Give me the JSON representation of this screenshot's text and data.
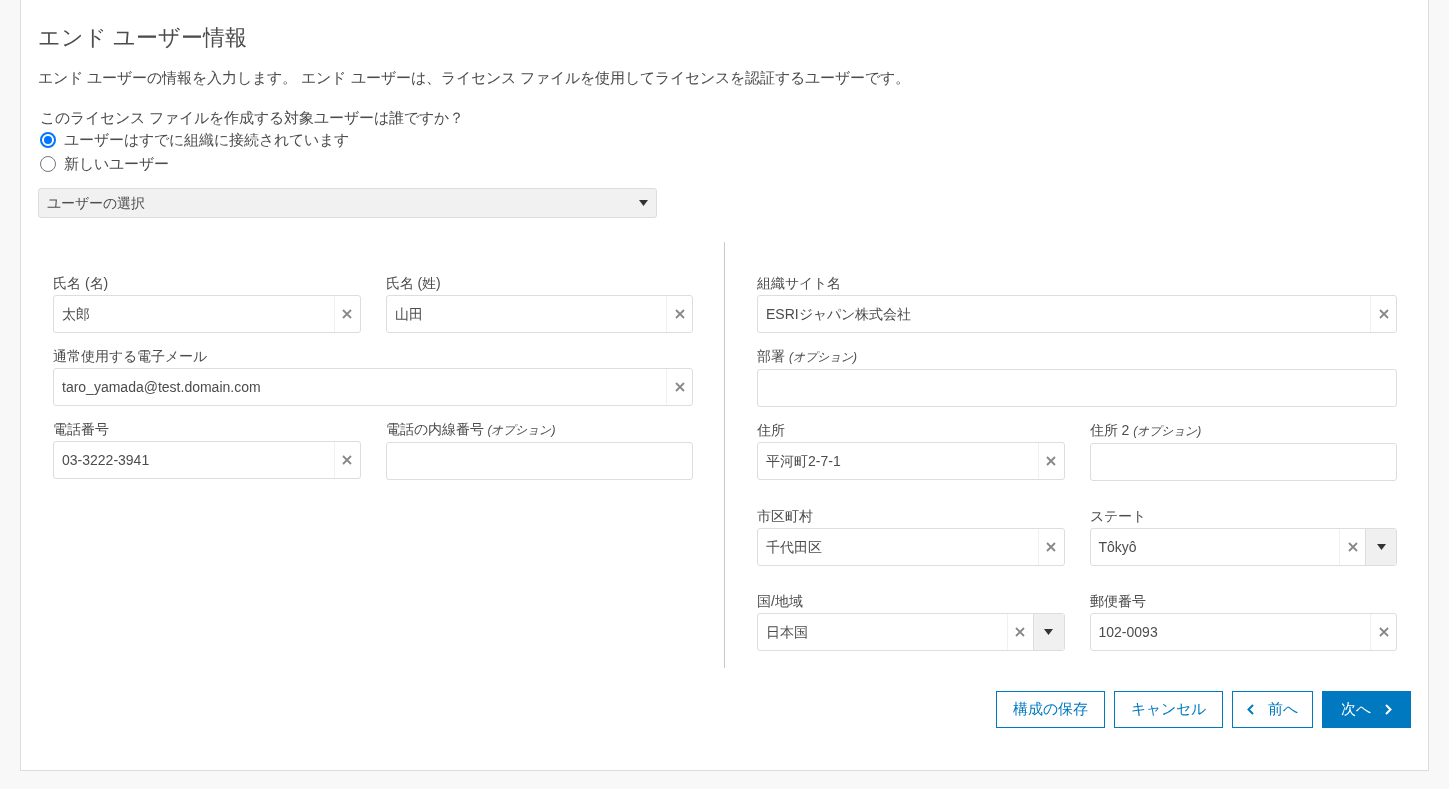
{
  "title": "エンド ユーザー情報",
  "description": "エンド ユーザーの情報を入力します。 エンド ユーザーは、ライセンス ファイルを使用してライセンスを認証するユーザーです。",
  "question": "このライセンス ファイルを作成する対象ユーザーは誰ですか？",
  "options": [
    {
      "label": "ユーザーはすでに組織に接続されています",
      "selected": true
    },
    {
      "label": "新しいユーザー",
      "selected": false
    }
  ],
  "user_select": {
    "value": "ユーザーの選択"
  },
  "columns": [
    {
      "rows": [
        [
          {
            "label": "氏名 (名)",
            "value": "太郎",
            "clearable": true,
            "dropdown": false
          },
          {
            "label": "氏名 (姓)",
            "value": "山田",
            "clearable": true,
            "dropdown": false
          }
        ],
        [
          {
            "label": "通常使用する電子メール",
            "value": "taro_yamada@test.domain.com",
            "clearable": true,
            "dropdown": false
          }
        ],
        [
          {
            "label": "電話番号",
            "value": "03-3222-3941",
            "clearable": true,
            "dropdown": false
          },
          {
            "label": "電話の内線番号",
            "optional": "(オプション)",
            "clearable": false,
            "dropdown": false
          }
        ]
      ]
    },
    {
      "rows": [
        [
          {
            "label": "組織サイト名",
            "value": "ESRIジャパン株式会社",
            "clearable": true,
            "dropdown": false
          }
        ],
        [
          {
            "label": "部署",
            "optional": "(オプション)",
            "clearable": false,
            "dropdown": false
          }
        ],
        [
          {
            "label": "住所",
            "value": "平河町2-7-1",
            "clearable": true,
            "dropdown": false
          },
          {
            "label": "住所 2",
            "optional": "(オプション)",
            "clearable": false,
            "dropdown": false
          }
        ],
        [
          {
            "label": "市区町村",
            "value": "千代田区",
            "clearable": true,
            "dropdown": false
          },
          {
            "label": "ステート",
            "value": "Tôkyô",
            "clearable": true,
            "dropdown": true
          }
        ],
        [
          {
            "label": "国/地域",
            "value": "日本国",
            "clearable": true,
            "dropdown": true
          },
          {
            "label": "郵便番号",
            "value": "102-0093",
            "clearable": true,
            "dropdown": false
          }
        ]
      ]
    }
  ],
  "buttons": [
    {
      "label": "構成の保存",
      "kind": "outline"
    },
    {
      "label": "キャンセル",
      "kind": "outline"
    },
    {
      "label": "前へ",
      "kind": "back"
    },
    {
      "label": "次へ",
      "kind": "next"
    }
  ]
}
